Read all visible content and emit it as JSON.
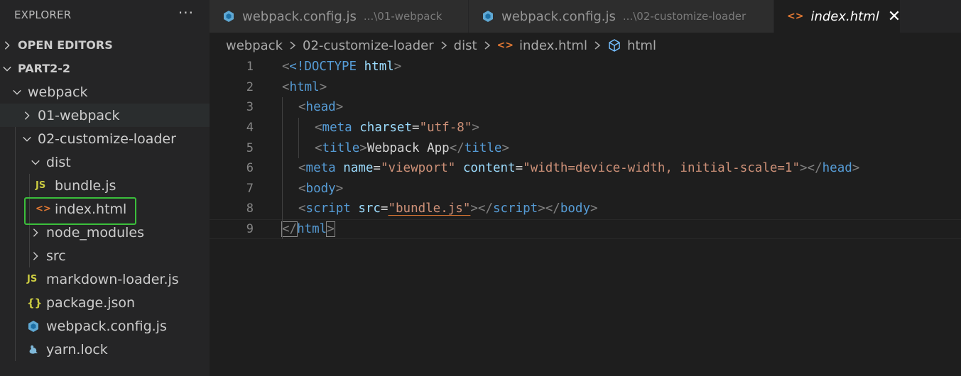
{
  "sidebar": {
    "title": "EXPLORER",
    "more_label": "···",
    "sections": {
      "open_editors": "OPEN EDITORS",
      "workspace": "PART2-2"
    },
    "tree": [
      {
        "label": "webpack",
        "type": "folder",
        "expanded": true,
        "depth": 0
      },
      {
        "label": "01-webpack",
        "type": "folder",
        "expanded": false,
        "depth": 1
      },
      {
        "label": "02-customize-loader",
        "type": "folder",
        "expanded": true,
        "depth": 1
      },
      {
        "label": "dist",
        "type": "folder",
        "expanded": true,
        "depth": 2
      },
      {
        "label": "bundle.js",
        "type": "js",
        "icon": "JS",
        "depth": 3
      },
      {
        "label": "index.html",
        "type": "html",
        "icon": "<>",
        "depth": 3,
        "selected": true
      },
      {
        "label": "node_modules",
        "type": "folder",
        "expanded": false,
        "depth": 2
      },
      {
        "label": "src",
        "type": "folder",
        "expanded": false,
        "depth": 2
      },
      {
        "label": "markdown-loader.js",
        "type": "js",
        "icon": "JS",
        "depth": 2
      },
      {
        "label": "package.json",
        "type": "json",
        "icon": "{}",
        "depth": 2
      },
      {
        "label": "webpack.config.js",
        "type": "webpack",
        "depth": 2
      },
      {
        "label": "yarn.lock",
        "type": "yarn",
        "depth": 2
      }
    ]
  },
  "tabs": [
    {
      "label": "webpack.config.js",
      "description": "...\\01-webpack",
      "icon": "webpack-icon",
      "active": false
    },
    {
      "label": "webpack.config.js",
      "description": "...\\02-customize-loader",
      "icon": "webpack-icon",
      "active": false
    },
    {
      "label": "index.html",
      "description": "",
      "icon": "html-icon",
      "active": true,
      "close": "✕"
    }
  ],
  "breadcrumb": [
    "webpack",
    "02-customize-loader",
    "dist",
    "index.html",
    "html"
  ],
  "editor": {
    "line_numbers": [
      "1",
      "2",
      "3",
      "4",
      "5",
      "6",
      "7",
      "8",
      "9"
    ],
    "tokens": {
      "doctype": "<!DOCTYPE",
      "doctype_html": "html",
      "gt": ">",
      "lt": "<",
      "lt_slash": "</",
      "html": "html",
      "head": "head",
      "meta": "meta",
      "charset": "charset",
      "charset_val": "\"utf-8\"",
      "title": "title",
      "title_text": "Webpack App",
      "name": "name",
      "name_val": "\"viewport\"",
      "content": "content",
      "content_val": "\"width=device-width, initial-scale=1\"",
      "body": "body",
      "script": "script",
      "src": "src",
      "src_val": "\"bundle.js\"",
      "eq": "="
    }
  },
  "colors": {
    "accent_outline": "#3bbf3b",
    "tag": "#569cd6",
    "attr": "#9cdcfe",
    "string": "#ce9178",
    "html_icon": "#e37933",
    "js_icon": "#cbcb41"
  }
}
